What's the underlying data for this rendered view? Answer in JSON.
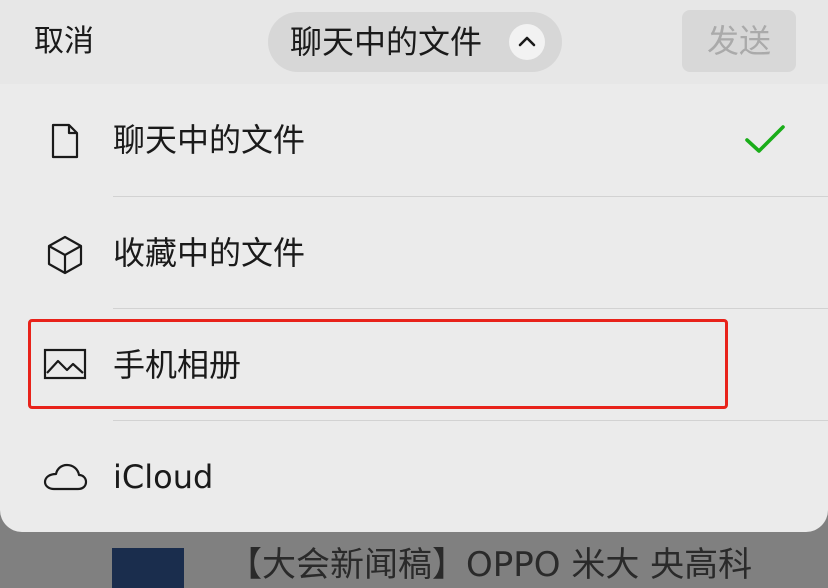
{
  "header": {
    "cancel_label": "取消",
    "title": "聊天中的文件",
    "send_label": "发送"
  },
  "menu": {
    "items": [
      {
        "label": "聊天中的文件",
        "icon": "document-icon",
        "selected": true
      },
      {
        "label": "收藏中的文件",
        "icon": "cube-icon",
        "selected": false
      },
      {
        "label": "手机相册",
        "icon": "photo-icon",
        "selected": false
      },
      {
        "label": "iCloud",
        "icon": "cloud-icon",
        "selected": false
      }
    ]
  },
  "background": {
    "partial_text": "【大会新闻稿】OPPO 米大 央高科"
  },
  "colors": {
    "check_green": "#1aad19",
    "highlight_red": "#e8221a"
  }
}
